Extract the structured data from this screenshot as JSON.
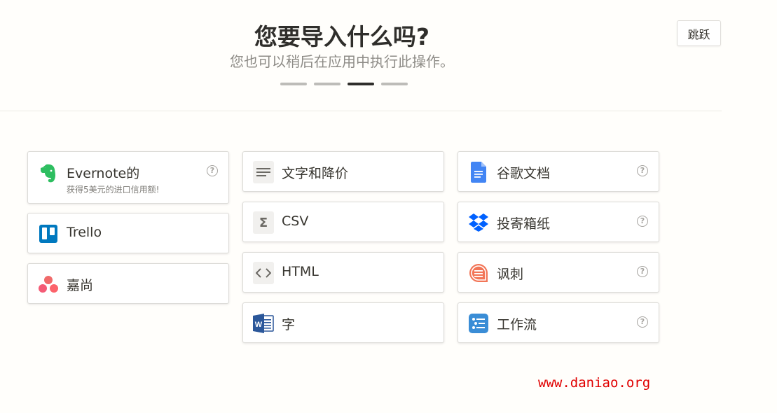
{
  "header": {
    "title": "您要导入什么吗?",
    "subtitle": "您也可以稍后在应用中执行此操作。",
    "skip_label": "跳跃",
    "steps_total": 4,
    "step_current": 3
  },
  "sources": {
    "col1": [
      {
        "label": "Evernote的",
        "sub": "获得5美元的进口信用额!",
        "icon": "evernote-icon",
        "help": "?"
      },
      {
        "label": "Trello",
        "icon": "trello-icon"
      },
      {
        "label": "嘉尚",
        "icon": "asana-icon"
      }
    ],
    "col2": [
      {
        "label": "文字和降价",
        "icon": "text-lines-icon"
      },
      {
        "label": "CSV",
        "icon": "sigma-icon"
      },
      {
        "label": "HTML",
        "icon": "code-brackets-icon"
      },
      {
        "label": "字",
        "icon": "word-icon"
      }
    ],
    "col3": [
      {
        "label": "谷歌文档",
        "icon": "google-docs-icon",
        "help": "?"
      },
      {
        "label": "投寄箱纸",
        "icon": "dropbox-icon",
        "help": "?"
      },
      {
        "label": "讽刺",
        "icon": "quip-icon",
        "help": "?"
      },
      {
        "label": "工作流",
        "icon": "workflowy-icon",
        "help": "?"
      }
    ]
  },
  "colors": {
    "accent": "#2f2e2b",
    "background": "#fffefb",
    "watermark": "#e00000"
  },
  "watermark": "www.daniao.org"
}
